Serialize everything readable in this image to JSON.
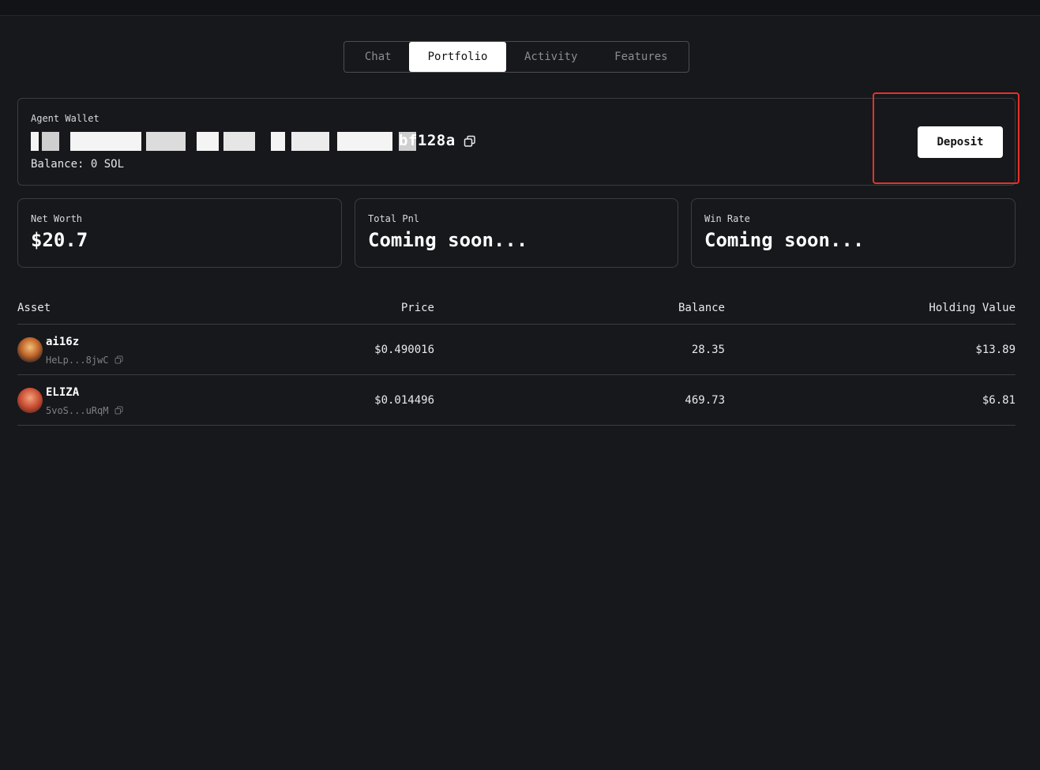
{
  "tabs": [
    {
      "label": "Chat"
    },
    {
      "label": "Portfolio"
    },
    {
      "label": "Activity"
    },
    {
      "label": "Features"
    }
  ],
  "active_tab": "Portfolio",
  "wallet": {
    "label": "Agent Wallet",
    "address_visible_suffix": "bf128a",
    "balance": "Balance: 0 SOL",
    "deposit_label": "Deposit"
  },
  "stats": [
    {
      "label": "Net Worth",
      "value": "$20.7"
    },
    {
      "label": "Total Pnl",
      "value": "Coming soon..."
    },
    {
      "label": "Win Rate",
      "value": "Coming soon..."
    }
  ],
  "table": {
    "headers": {
      "asset": "Asset",
      "price": "Price",
      "balance": "Balance",
      "holding_value": "Holding Value"
    },
    "rows": [
      {
        "name": "ai16z",
        "address": "HeLp...8jwC",
        "price": "$0.490016",
        "balance": "28.35",
        "holding_value": "$13.89"
      },
      {
        "name": "ELIZA",
        "address": "5voS...uRqM",
        "price": "$0.014496",
        "balance": "469.73",
        "holding_value": "$6.81"
      }
    ]
  },
  "colors": {
    "highlight": "#e8302a",
    "background": "#16181b"
  }
}
